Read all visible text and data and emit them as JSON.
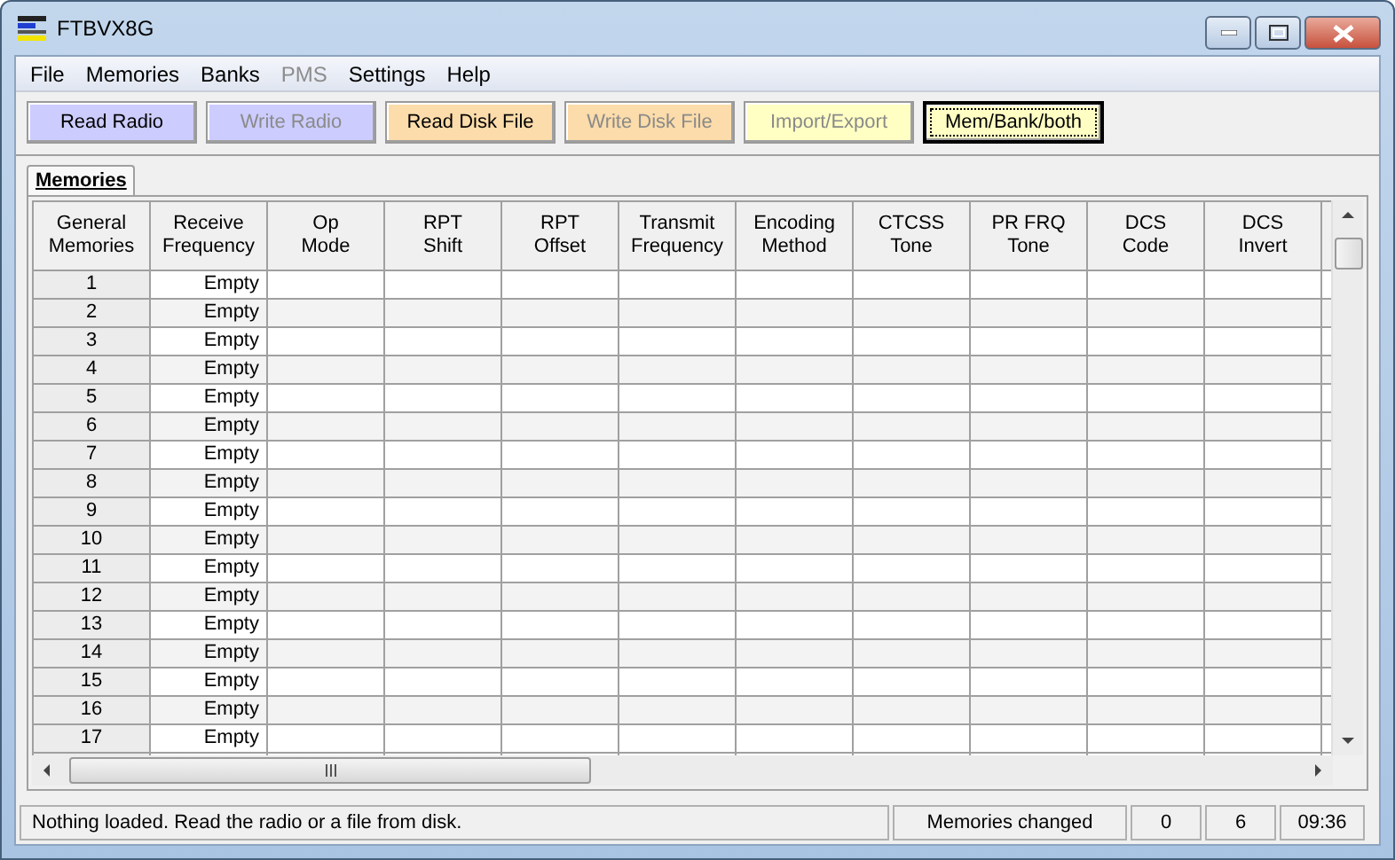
{
  "window": {
    "title": "FTBVX8G"
  },
  "menu": [
    {
      "label": "File",
      "disabled": false
    },
    {
      "label": "Memories",
      "disabled": false
    },
    {
      "label": "Banks",
      "disabled": false
    },
    {
      "label": "PMS",
      "disabled": true
    },
    {
      "label": "Settings",
      "disabled": false
    },
    {
      "label": "Help",
      "disabled": false
    }
  ],
  "toolbar": [
    {
      "label": "Read Radio",
      "kind": "radio",
      "disabled": false,
      "focused": false
    },
    {
      "label": "Write Radio",
      "kind": "radio",
      "disabled": true,
      "focused": false
    },
    {
      "label": "Read Disk File",
      "kind": "disk",
      "disabled": false,
      "focused": false
    },
    {
      "label": "Write Disk File",
      "kind": "disk",
      "disabled": true,
      "focused": false
    },
    {
      "label": "Import/Export",
      "kind": "transfer",
      "disabled": true,
      "focused": false
    },
    {
      "label": "Mem/Bank/both",
      "kind": "transfer",
      "disabled": false,
      "focused": true
    }
  ],
  "tabs": [
    {
      "label": "Memories",
      "selected": true
    }
  ],
  "table": {
    "columns": [
      "General\nMemories",
      "Receive\nFrequency",
      "Op\nMode",
      "RPT\nShift",
      "RPT\nOffset",
      "Transmit\nFrequency",
      "Encoding\nMethod",
      "CTCSS\nTone",
      "PR FRQ\nTone",
      "DCS\nCode",
      "DCS\nInvert"
    ],
    "rows": [
      {
        "number": "1",
        "receive_frequency": "Empty"
      },
      {
        "number": "2",
        "receive_frequency": "Empty"
      },
      {
        "number": "3",
        "receive_frequency": "Empty"
      },
      {
        "number": "4",
        "receive_frequency": "Empty"
      },
      {
        "number": "5",
        "receive_frequency": "Empty"
      },
      {
        "number": "6",
        "receive_frequency": "Empty"
      },
      {
        "number": "7",
        "receive_frequency": "Empty"
      },
      {
        "number": "8",
        "receive_frequency": "Empty"
      },
      {
        "number": "9",
        "receive_frequency": "Empty"
      },
      {
        "number": "10",
        "receive_frequency": "Empty"
      },
      {
        "number": "11",
        "receive_frequency": "Empty"
      },
      {
        "number": "12",
        "receive_frequency": "Empty"
      },
      {
        "number": "13",
        "receive_frequency": "Empty"
      },
      {
        "number": "14",
        "receive_frequency": "Empty"
      },
      {
        "number": "15",
        "receive_frequency": "Empty"
      },
      {
        "number": "16",
        "receive_frequency": "Empty"
      },
      {
        "number": "17",
        "receive_frequency": "Empty"
      }
    ]
  },
  "status_bar": {
    "message": "Nothing loaded. Read the radio or a file from disk.",
    "label": "Memories changed",
    "count_1": "0",
    "count_2": "6",
    "time": "09:36"
  }
}
